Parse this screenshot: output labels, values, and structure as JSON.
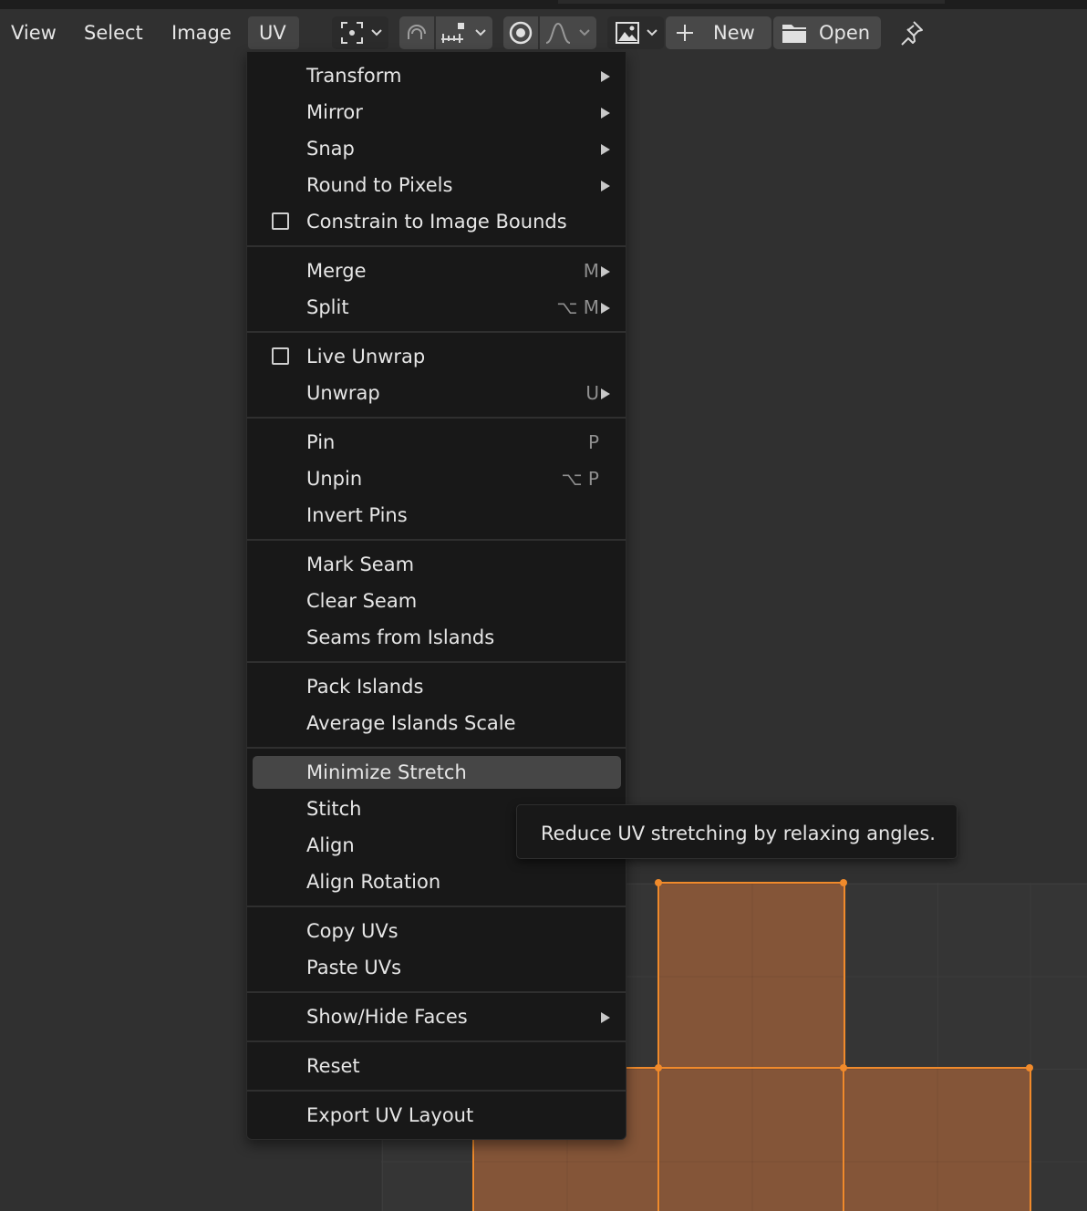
{
  "header": {
    "menus": [
      "View",
      "Select",
      "Image",
      "UV"
    ],
    "active_menu": "UV",
    "new_label": "New",
    "open_label": "Open"
  },
  "uv_menu": {
    "items": [
      {
        "label": "Transform",
        "submenu": true
      },
      {
        "label": "Mirror",
        "submenu": true
      },
      {
        "label": "Snap",
        "submenu": true
      },
      {
        "label": "Round to Pixels",
        "submenu": true
      },
      {
        "label": "Constrain to Image Bounds",
        "checkbox": true,
        "checked": false
      },
      {
        "label": "Merge",
        "shortcut": "M",
        "submenu": true
      },
      {
        "label": "Split",
        "shortcut": "⌥ M",
        "submenu": true
      },
      {
        "label": "Live Unwrap",
        "checkbox": true,
        "checked": false
      },
      {
        "label": "Unwrap",
        "shortcut": "U",
        "submenu": true
      },
      {
        "label": "Pin",
        "shortcut": "P"
      },
      {
        "label": "Unpin",
        "shortcut": "⌥ P"
      },
      {
        "label": "Invert Pins"
      },
      {
        "label": "Mark Seam"
      },
      {
        "label": "Clear Seam"
      },
      {
        "label": "Seams from Islands"
      },
      {
        "label": "Pack Islands"
      },
      {
        "label": "Average Islands Scale"
      },
      {
        "label": "Minimize Stretch",
        "highlighted": true
      },
      {
        "label": "Stitch"
      },
      {
        "label": "Align"
      },
      {
        "label": "Align Rotation"
      },
      {
        "label": "Copy UVs"
      },
      {
        "label": "Paste UVs"
      },
      {
        "label": "Show/Hide Faces",
        "submenu": true
      },
      {
        "label": "Reset"
      },
      {
        "label": "Export UV Layout"
      }
    ]
  },
  "tooltip": {
    "text": "Reduce UV stretching by relaxing angles."
  },
  "colors": {
    "menu_bg": "#181818",
    "highlight": "#464646",
    "uv_face": "#845538",
    "uv_edge": "#f08a2b"
  }
}
